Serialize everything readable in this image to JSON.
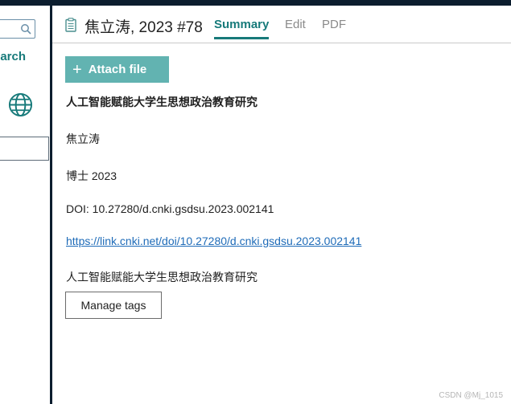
{
  "sidebar": {
    "search_link": "earch"
  },
  "header": {
    "title": "焦立涛, 2023 #78",
    "tabs": [
      {
        "label": "Summary",
        "active": true
      },
      {
        "label": "Edit",
        "active": false
      },
      {
        "label": "PDF",
        "active": false
      }
    ]
  },
  "content": {
    "attach_button": {
      "icon": "+",
      "label": "Attach file"
    },
    "title": "人工智能赋能大学生思想政治教育研究",
    "author": "焦立涛",
    "degree_year": "博士 2023",
    "doi": "DOI: 10.27280/d.cnki.gsdsu.2023.002141",
    "url": "https://link.cnki.net/doi/10.27280/d.cnki.gsdsu.2023.002141",
    "extra": "人工智能赋能大学生思想政治教育研究",
    "manage_tags_label": "Manage tags"
  },
  "watermark": "CSDN @Mj_1015",
  "colors": {
    "accent": "#177a7a",
    "attach_button_bg": "#62b3b1",
    "link": "#1e6bb8",
    "topbar": "#0b1d2e"
  }
}
